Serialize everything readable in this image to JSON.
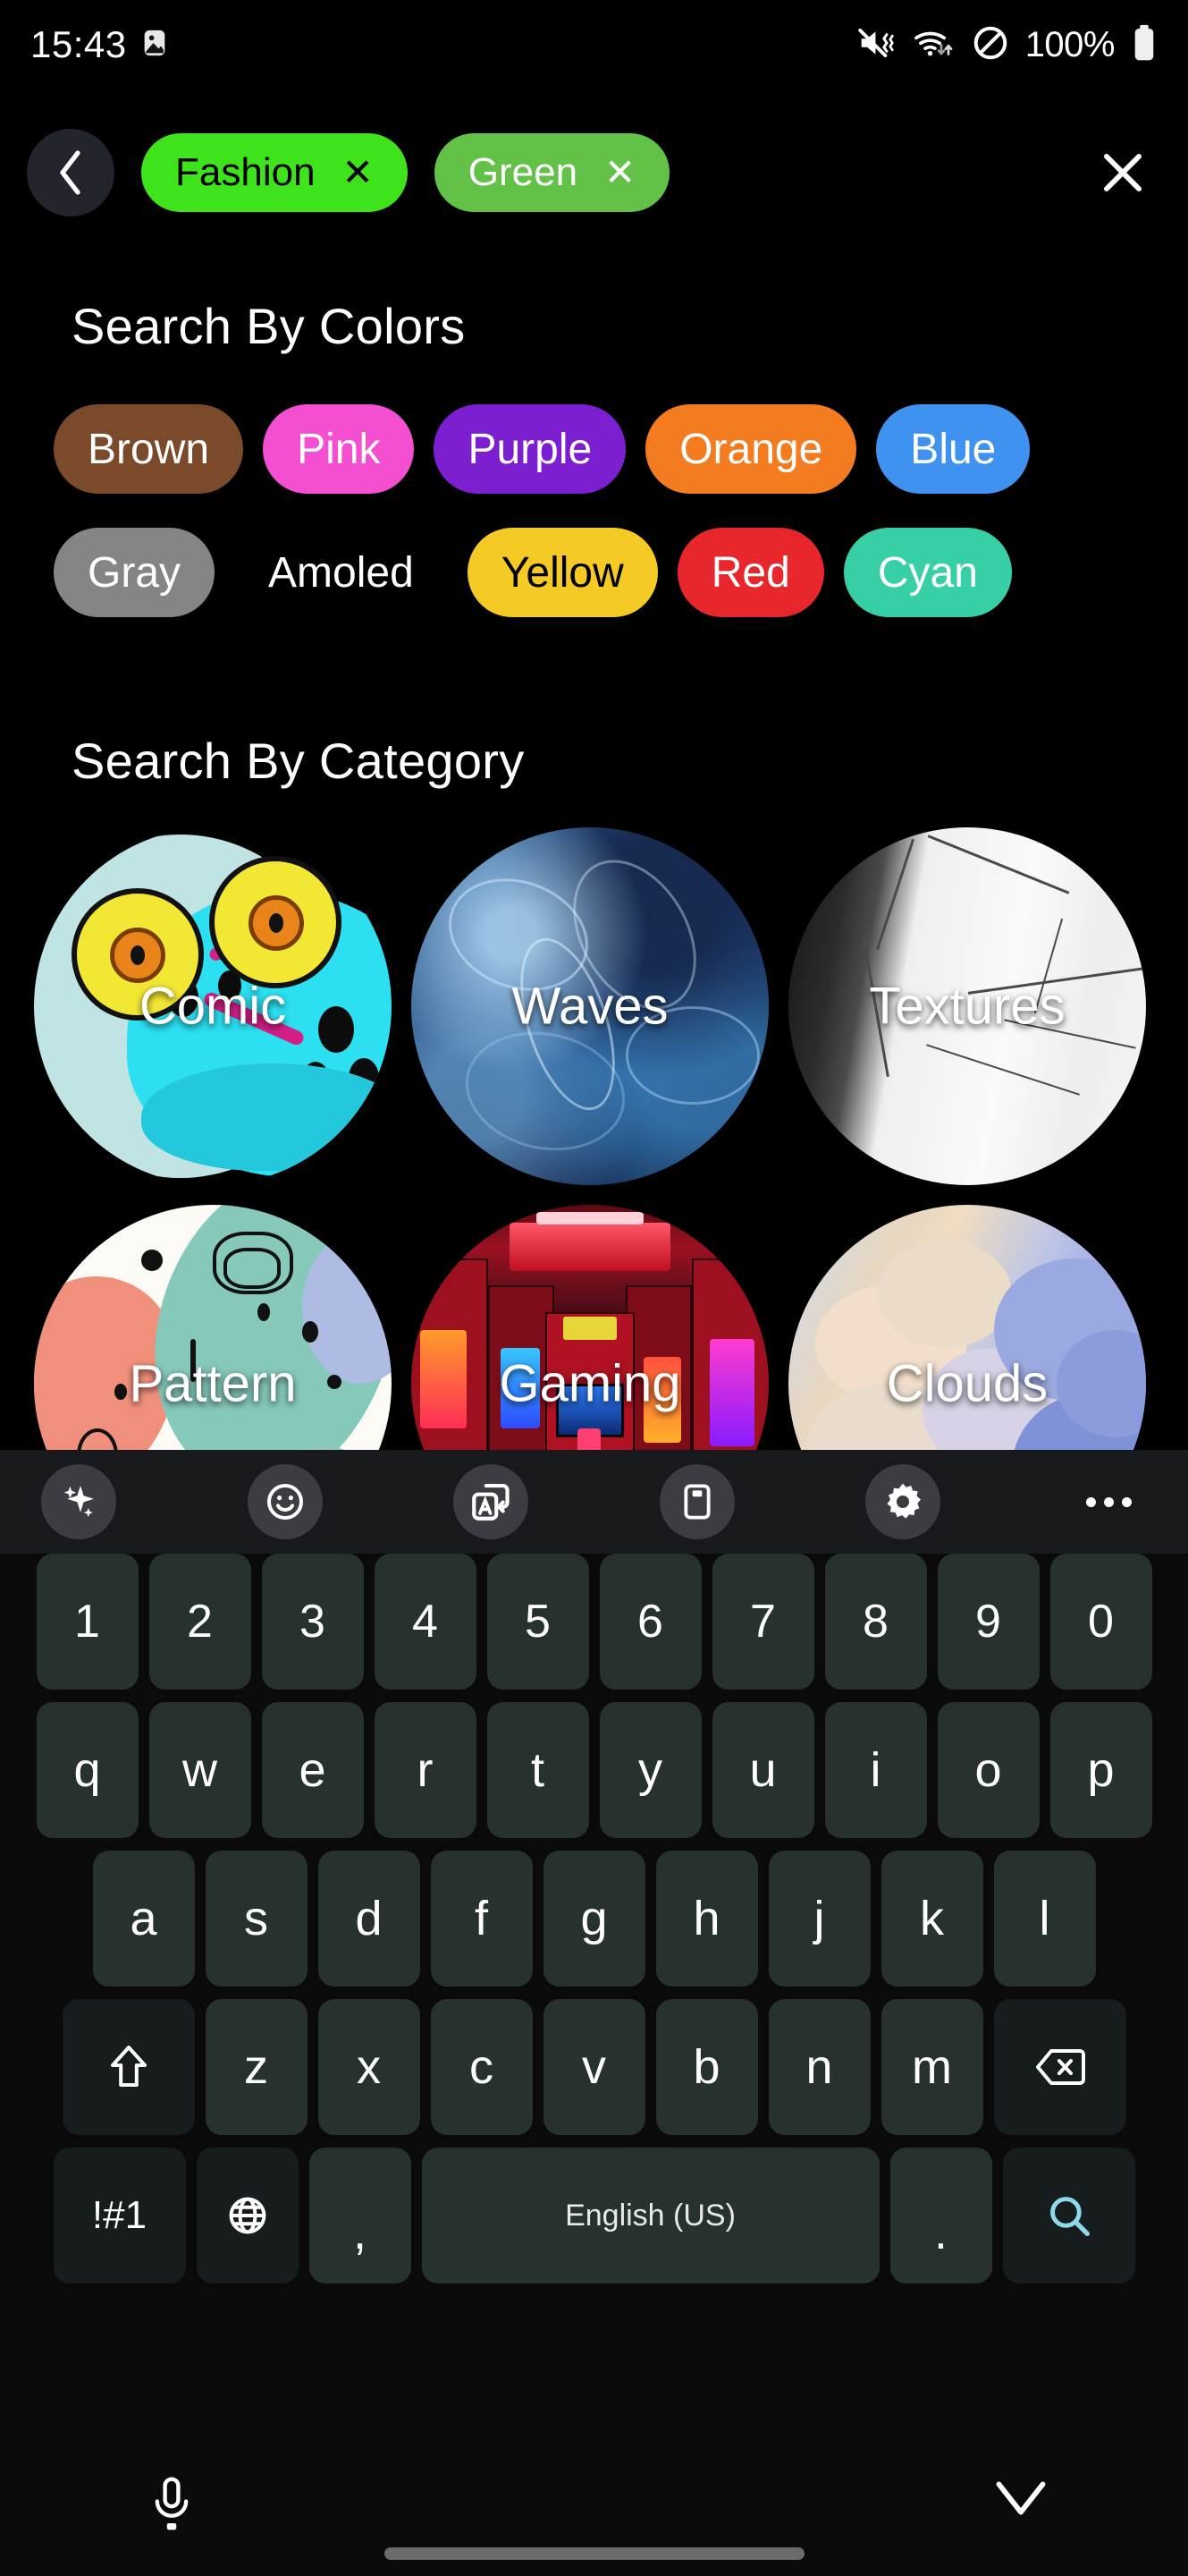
{
  "status_bar": {
    "time": "15:43",
    "battery_percent": "100%",
    "icons": [
      "image-icon",
      "mute-vibrate-icon",
      "wifi-icon",
      "do-not-disturb-icon",
      "battery-icon"
    ]
  },
  "header": {
    "back_label": "‹",
    "close_label": "✕",
    "chips": [
      {
        "label": "Fashion",
        "remove": "✕",
        "bg": "#3ee31b",
        "fg": "#000000"
      },
      {
        "label": "Green",
        "remove": "✕",
        "bg": "#62c247",
        "fg": "#ffffff"
      }
    ]
  },
  "colors_section": {
    "title": "Search By Colors",
    "row1": [
      {
        "label": "Brown",
        "bg": "#7a4a2b",
        "fg": "#ffffff"
      },
      {
        "label": "Pink",
        "bg": "#f44fd1",
        "fg": "#ffffff"
      },
      {
        "label": "Purple",
        "bg": "#7b1fd1",
        "fg": "#ffffff"
      },
      {
        "label": "Orange",
        "bg": "#f47c20",
        "fg": "#ffffff"
      },
      {
        "label": "Blue",
        "bg": "#3f92f0",
        "fg": "#ffffff"
      }
    ],
    "row2": [
      {
        "label": "Gray",
        "bg": "#858585",
        "fg": "#ffffff"
      },
      {
        "label": "Amoled",
        "bg": "#000000",
        "fg": "#ffffff"
      },
      {
        "label": "Yellow",
        "bg": "#f5ca24",
        "fg": "#000000"
      },
      {
        "label": "Red",
        "bg": "#e8272c",
        "fg": "#ffffff"
      },
      {
        "label": "Cyan",
        "bg": "#36cfa6",
        "fg": "#ffffff"
      }
    ]
  },
  "category_section": {
    "title": "Search By Category",
    "row1": [
      {
        "label": "Comic"
      },
      {
        "label": "Waves"
      },
      {
        "label": "Textures"
      }
    ],
    "row2": [
      {
        "label": "Pattern"
      },
      {
        "label": "Gaming"
      },
      {
        "label": "Clouds"
      }
    ]
  },
  "keyboard": {
    "toolbar": [
      "sparkles-icon",
      "emoji-icon",
      "translate-icon",
      "clipboard-icon",
      "gear-icon",
      "more-options-icon"
    ],
    "row_numbers": [
      "1",
      "2",
      "3",
      "4",
      "5",
      "6",
      "7",
      "8",
      "9",
      "0"
    ],
    "row_top": [
      "q",
      "w",
      "e",
      "r",
      "t",
      "y",
      "u",
      "i",
      "o",
      "p"
    ],
    "row_home": [
      "a",
      "s",
      "d",
      "f",
      "g",
      "h",
      "j",
      "k",
      "l"
    ],
    "row_bottom": [
      "z",
      "x",
      "c",
      "v",
      "b",
      "n",
      "m"
    ],
    "shift_label": "⇧",
    "backspace_label": "⌫",
    "symbols_label": "!#1",
    "language_globe_label": "🌐",
    "comma_label": ",",
    "space_label": "English (US)",
    "period_label": ".",
    "search_label": "search-icon"
  },
  "nav_bar": {
    "mic_label": "microphone-icon",
    "collapse_label": "chevron-down-icon"
  },
  "theme": {
    "background": "#000000",
    "keyboard_bg": "#0a0a0a",
    "key_bg": "#27322f",
    "key_dark_bg": "#171c1e",
    "toolbar_bg": "#17191c",
    "accent_cyan": "#8fd8e8"
  }
}
